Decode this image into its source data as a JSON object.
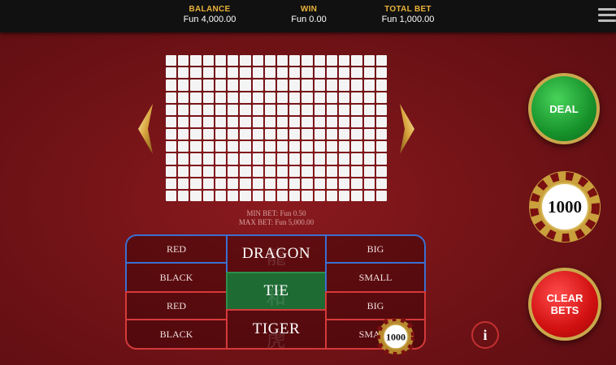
{
  "header": {
    "balance_label": "BALANCE",
    "balance_value": "Fun 4,000.00",
    "win_label": "WIN",
    "win_value": "Fun 0.00",
    "total_bet_label": "TOTAL BET",
    "total_bet_value": "Fun 1,000.00"
  },
  "roadmap": {
    "columns": 18,
    "rows": 12
  },
  "limits": {
    "min_bet": "MIN BET: Fun 0.50",
    "max_bet": "MAX BET: Fun 5,000.00"
  },
  "table": {
    "dragon_red": "RED",
    "dragon_black": "BLACK",
    "dragon": "DRAGON",
    "tie": "TIE",
    "tiger": "TIGER",
    "dragon_big": "BIG",
    "dragon_small": "SMALL",
    "tiger_red": "RED",
    "tiger_black": "BLACK",
    "tiger_big": "BIG",
    "tiger_small": "SMALL",
    "watermark_dragon": "龍",
    "watermark_tie": "和",
    "watermark_tiger": "虎"
  },
  "chips": {
    "placed_chip_value": "1000",
    "selected_chip_value": "1000"
  },
  "buttons": {
    "deal": "DEAL",
    "clear_bets_line1": "CLEAR",
    "clear_bets_line2": "BETS",
    "info": "i"
  },
  "icons": {
    "menu": "hamburger-icon",
    "prev": "chevron-left-icon",
    "next": "chevron-right-icon",
    "info": "info-icon"
  },
  "colors": {
    "accent_gold": "#e8b23a",
    "dragon_side": "#3b6fd1",
    "tiger_side": "#d53a3a",
    "tie_green": "#1f6b34"
  }
}
